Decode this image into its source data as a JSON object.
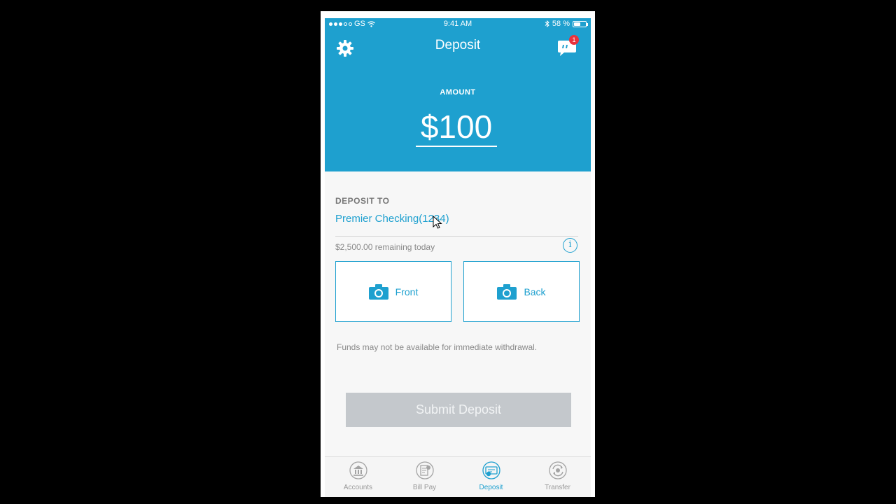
{
  "status_bar": {
    "carrier": "GS",
    "time": "9:41 AM",
    "battery": "58 %",
    "battery_level_percent": 58
  },
  "header": {
    "title": "Deposit",
    "settings_icon": "gear-icon",
    "chat_icon": "chat-bubble-icon",
    "chat_badge_count": "1",
    "amount_label": "AMOUNT",
    "amount_value": "$100"
  },
  "deposit_to": {
    "label": "DEPOSIT TO",
    "account": "Premier Checking(1234)",
    "remaining": "$2,500.00 remaining today",
    "info_icon": "info-icon",
    "info_glyph": "i"
  },
  "capture": {
    "front_label": "Front",
    "back_label": "Back",
    "icon": "camera-icon"
  },
  "funds_note": "Funds may not be available for immediate withdrawal.",
  "submit_button": {
    "label": "Submit Deposit",
    "state": "disabled"
  },
  "tabbar": {
    "items": [
      {
        "label": "Accounts",
        "icon": "bank-icon"
      },
      {
        "label": "Bill Pay",
        "icon": "bill-pay-icon"
      },
      {
        "label": "Deposit",
        "icon": "deposit-check-icon",
        "active": true
      },
      {
        "label": "Transfer",
        "icon": "transfer-icon"
      }
    ]
  },
  "colors": {
    "accent": "#1ea0cf",
    "badge": "#e8323c",
    "disabled_button": "#c4c8cc"
  }
}
